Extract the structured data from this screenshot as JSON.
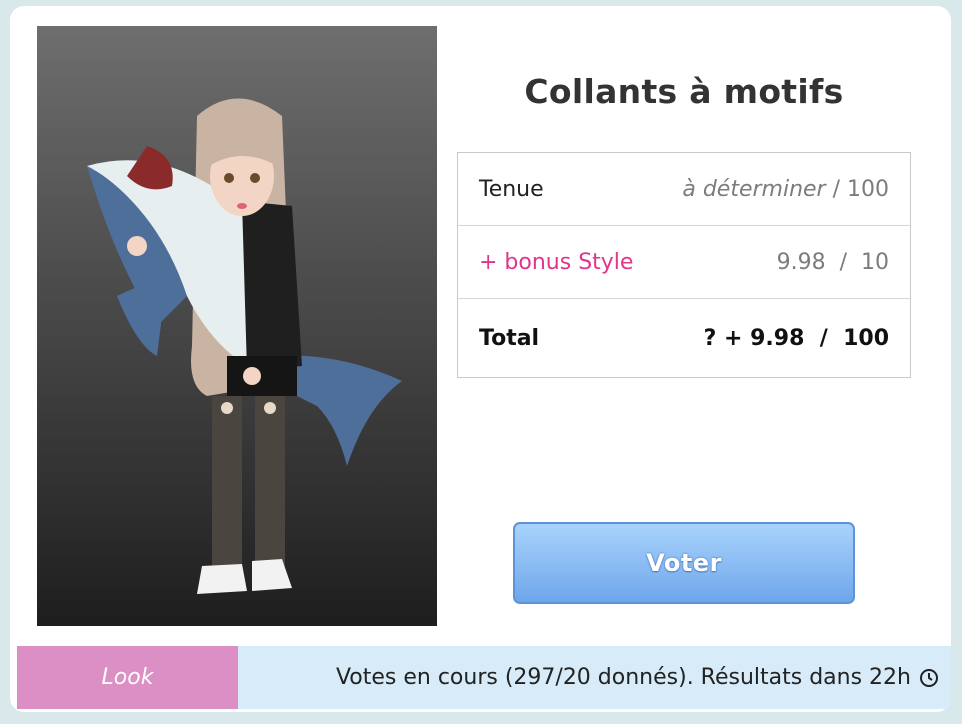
{
  "look": {
    "title": "Collants à motifs",
    "image_alt": "avatar-with-shark-plush"
  },
  "scores": {
    "outfit": {
      "label": "Tenue",
      "value_italic": "à déterminer",
      "value_suffix": " / 100"
    },
    "bonus": {
      "label": "+ bonus Style",
      "value": "9.98  /  10"
    },
    "total": {
      "label": "Total",
      "value": "? + 9.98  /  100"
    }
  },
  "actions": {
    "vote_label": "Voter"
  },
  "footer": {
    "tab_label": "Look",
    "status_text": "Votes en cours (297/20 donnés). Résultats dans 22h"
  },
  "colors": {
    "accent_pink": "#e0358b",
    "tab_pink": "#dc8fc4",
    "button_blue": "#6ea6ec",
    "footer_bg": "#d8ebf8"
  },
  "icons": {
    "status": "clock-icon"
  }
}
